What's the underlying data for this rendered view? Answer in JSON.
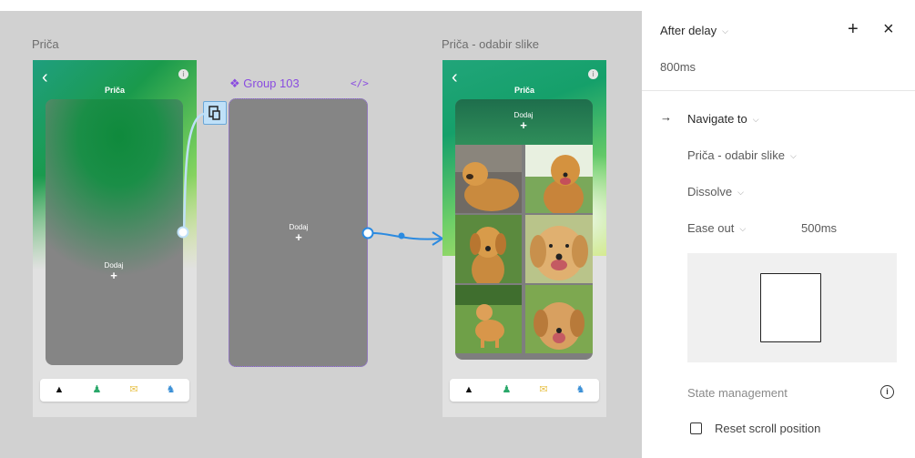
{
  "canvas": {
    "left_frame": {
      "label": "Priča",
      "title": "Priča",
      "card_text": "Dodaj",
      "card_plus": "+",
      "info_icon": "i"
    },
    "group": {
      "label": "Group 103",
      "code_icon": "</>",
      "card_text": "Dodaj",
      "card_plus": "+"
    },
    "right_frame": {
      "label": "Priča - odabir slike",
      "title": "Priča",
      "dodaj_text": "Dodaj",
      "dodaj_plus": "+",
      "info_icon": "i"
    },
    "navbar_icons": [
      "home-icon",
      "person-icon",
      "mail-icon",
      "pet-icon"
    ],
    "colors": {
      "canvas_bg": "#d1d1d1",
      "selection_purple": "#8a4ce0",
      "connector_blue": "#2b8ae0"
    }
  },
  "panel": {
    "trigger": "After delay",
    "delay_value": "800ms",
    "add_icon": "+",
    "close_icon": "×",
    "action_arrow": "→",
    "action": "Navigate to",
    "destination": "Priča - odabir slike",
    "animation": "Dissolve",
    "easing": "Ease out",
    "duration": "500ms",
    "state_management": "State management",
    "info_icon": "i",
    "reset_scroll": "Reset scroll position"
  }
}
